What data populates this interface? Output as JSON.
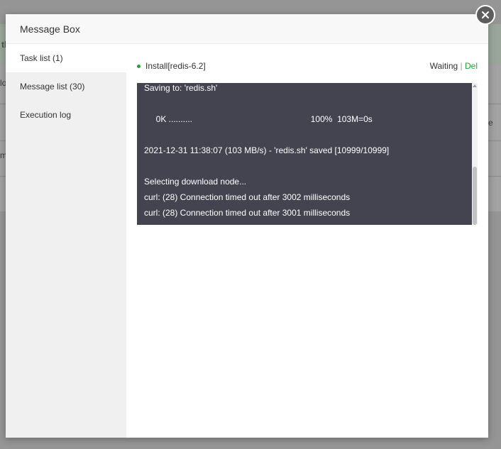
{
  "background": {
    "fragments": [
      "th",
      "lo",
      "e",
      "m"
    ]
  },
  "modal": {
    "title": "Message Box"
  },
  "sidebar": {
    "items": [
      {
        "label": "Task list (1)",
        "active": true
      },
      {
        "label": "Message list (30)",
        "active": false
      },
      {
        "label": "Execution log",
        "active": false
      }
    ]
  },
  "task": {
    "name": "Install[redis-6.2]",
    "status": "Waiting",
    "separator": "|",
    "delete_label": "Del"
  },
  "log": {
    "lines": [
      "Saving to: 'redis.sh'",
      "",
      "     0K ..........                                                  100%  103M=0s",
      "",
      "2021-12-31 11:38:07 (103 MB/s) - 'redis.sh' saved [10999/10999]",
      "",
      "Selecting download node...",
      "curl: (28) Connection timed out after 3002 milliseconds",
      "curl: (28) Connection timed out after 3001 milliseconds"
    ]
  },
  "colors": {
    "accent_green": "#20a53a",
    "log_background": "#444451",
    "overlay": "#959595"
  },
  "icons": {
    "close": "close-icon",
    "status_dot": "status-dot-icon"
  }
}
